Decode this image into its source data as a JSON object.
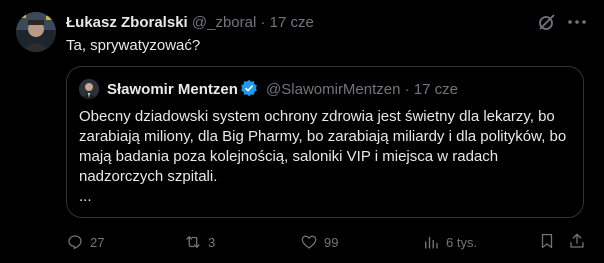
{
  "tweet": {
    "author_name": "Łukasz Zboralski",
    "author_handle": "@_zboral",
    "separator": "·",
    "time": "17 cze",
    "text": "Ta, sprywatyzować?"
  },
  "quote": {
    "author_name": "Sławomir Mentzen",
    "author_handle": "@SlawomirMentzen",
    "separator": "·",
    "time": "17 cze",
    "text": "Obecny dziadowski system ochrony zdrowia jest świetny dla lekarzy, bo zarabiają miliony, dla Big Pharmy, bo zarabiają miliardy i dla polityków, bo mają badania poza kolejnością, saloniki VIP i miejsca w radach nadzorczych szpitali.",
    "ellipsis": "..."
  },
  "actions": {
    "replies": "27",
    "reposts": "3",
    "likes": "99",
    "views": "6 tys."
  },
  "icons": {
    "grok": "grok-icon",
    "more": "more-icon",
    "verified": "verified-badge-icon",
    "reply": "reply-icon",
    "repost": "repost-icon",
    "like": "heart-icon",
    "views": "views-icon",
    "bookmark": "bookmark-icon",
    "share": "share-icon"
  },
  "colors": {
    "background": "#000000",
    "text": "#e7e9ea",
    "muted": "#71767b",
    "border": "#2f3336",
    "verified": "#1d9bf0"
  }
}
